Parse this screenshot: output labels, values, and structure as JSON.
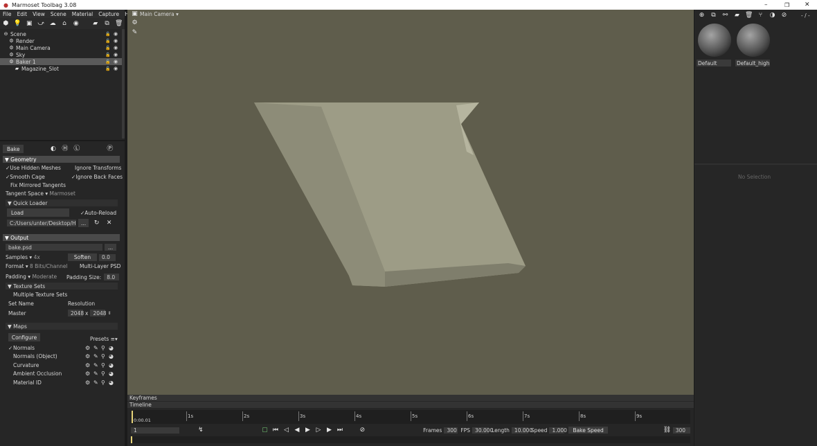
{
  "window": {
    "title": "Marmoset Toolbag 3.08"
  },
  "menu": [
    "File",
    "Edit",
    "View",
    "Scene",
    "Material",
    "Capture",
    "Help"
  ],
  "viewport": {
    "camera_label": "Main Camera"
  },
  "scene_tree": [
    {
      "label": "Scene",
      "indent": 0
    },
    {
      "label": "Render",
      "indent": 1
    },
    {
      "label": "Main Camera",
      "indent": 1
    },
    {
      "label": "Sky",
      "indent": 1
    },
    {
      "label": "Baker 1",
      "indent": 1,
      "selected": true
    },
    {
      "label": "Magazine_Slot",
      "indent": 2
    }
  ],
  "bake": {
    "tab_label": "Bake",
    "geometry_header": "Geometry",
    "use_hidden_meshes": "Use Hidden Meshes",
    "ignore_transforms": "Ignore Transforms",
    "smooth_cage": "Smooth Cage",
    "ignore_back_faces": "Ignore Back Faces",
    "fix_mirrored": "Fix Mirrored Tangents",
    "tangent_space_label": "Tangent Space",
    "tangent_space_value": "Marmoset",
    "quick_loader": "Quick Loader",
    "load_button": "Load",
    "auto_reload": "Auto-Reload",
    "path": "C:/Users/unter/Desktop/Hanc",
    "path_more": "...",
    "output_header": "Output",
    "output_file": "bake.psd",
    "output_more": "...",
    "samples_label": "Samples",
    "samples_value": "4x",
    "soften_label": "Soften",
    "soften_value": "0.0",
    "format_label": "Format",
    "format_value": "8 Bits/Channel",
    "multilayer": "Multi-Layer PSD",
    "padding_label": "Padding",
    "padding_value": "Moderate",
    "padding_size_label": "Padding Size:",
    "padding_size_value": "8.0",
    "texture_sets": "Texture Sets",
    "multiple_texture_sets": "Multiple Texture Sets",
    "set_name": "Set Name",
    "resolution": "Resolution",
    "master": "Master",
    "res_w": "2048",
    "res_x": "x",
    "res_h": "2048",
    "maps_header": "Maps",
    "configure": "Configure",
    "presets": "Presets",
    "maps": [
      "Normals",
      "Normals (Object)",
      "Curvature",
      "Ambient Occlusion",
      "Material ID"
    ]
  },
  "materials": [
    {
      "label": "Default"
    },
    {
      "label": "Default_high"
    }
  ],
  "material_counter": "- / -",
  "no_selection": "No Selection",
  "timeline": {
    "keyframes": "Keyframes",
    "timeline": "Timeline",
    "current_time": "0:00.01",
    "ticks": [
      "1s",
      "2s",
      "3s",
      "4s",
      "5s",
      "6s",
      "7s",
      "8s",
      "9s"
    ],
    "frame_value": "1",
    "frames_label": "Frames",
    "frames_value": "300",
    "fps_label": "FPS",
    "fps_value": "30.000",
    "length_label": "Length",
    "length_value": "10.000",
    "speed_label": "Speed",
    "speed_value": "1.000",
    "bake_speed": "Bake Speed",
    "end_frame": "300"
  }
}
